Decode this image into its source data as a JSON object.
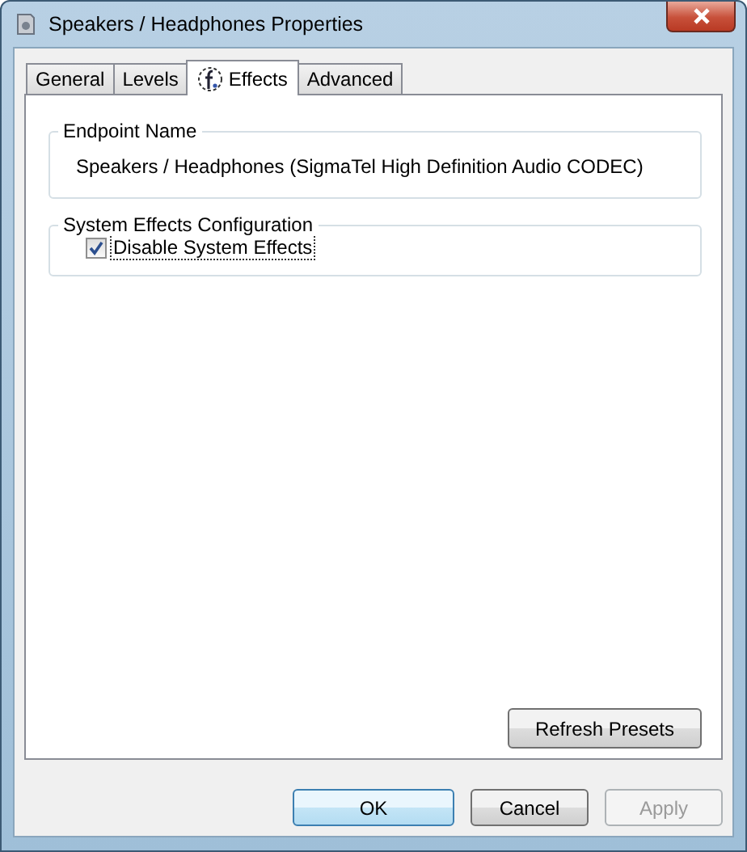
{
  "window": {
    "title": "Speakers / Headphones Properties"
  },
  "tabs": [
    {
      "label": "General",
      "selected": false
    },
    {
      "label": "Levels",
      "selected": false
    },
    {
      "label": "Effects",
      "selected": true,
      "icon": true
    },
    {
      "label": "Advanced",
      "selected": false
    }
  ],
  "endpoint_group": {
    "title": "Endpoint Name",
    "value": "Speakers / Headphones (SigmaTel High Definition Audio CODEC)"
  },
  "effects_group": {
    "title": "System Effects Configuration",
    "checkbox": {
      "label": "Disable System Effects",
      "checked": true,
      "focused": true
    }
  },
  "refresh_button": {
    "label": "Refresh Presets"
  },
  "buttons": [
    {
      "label": "OK",
      "kind": "default",
      "disabled": false
    },
    {
      "label": "Cancel",
      "kind": "normal",
      "disabled": false
    },
    {
      "label": "Apply",
      "kind": "normal",
      "disabled": true
    }
  ]
}
